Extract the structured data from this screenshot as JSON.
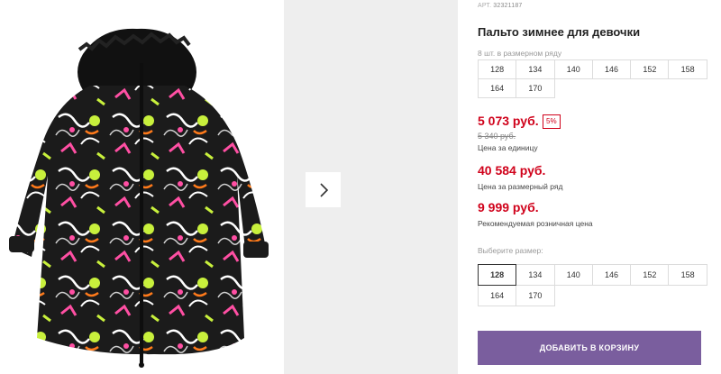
{
  "product": {
    "article_label": "АРТ.",
    "article": "32321187",
    "title": "Пальто зимнее для девочки",
    "pack_label": "8 шт. в размерном ряду",
    "pack_sizes": [
      "128",
      "134",
      "140",
      "146",
      "152",
      "158",
      "164",
      "170"
    ]
  },
  "pricing": {
    "unit_price": "5 073 руб.",
    "discount": "5%",
    "old_price": "5 340 руб.",
    "unit_caption": "Цена за единицу",
    "pack_price": "40 584 руб.",
    "pack_caption": "Цена за размерный ряд",
    "rrp": "9 999 руб.",
    "rrp_caption": "Рекомендуемая розничная цена"
  },
  "size_selector": {
    "label": "Выберите размер:",
    "options": [
      "128",
      "134",
      "140",
      "146",
      "152",
      "158",
      "164",
      "170"
    ],
    "selected": "128"
  },
  "cart": {
    "add_label": "ДОБАВИТЬ В КОРЗИНУ"
  },
  "gallery": {
    "next_icon": "chevron-right-icon"
  },
  "colors": {
    "price_red": "#d0021b",
    "button_purple": "#7a5e9e",
    "gallery_gray": "#eeeeee"
  }
}
